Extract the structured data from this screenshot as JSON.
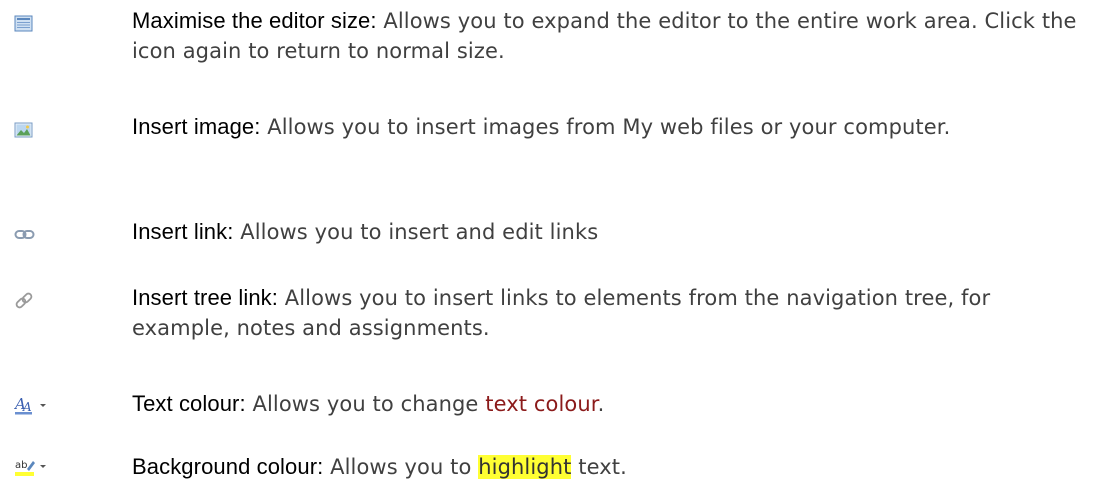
{
  "items": [
    {
      "icon": "maximise-editor-icon",
      "term": "Maximise the editor size:",
      "desc": " Allows you to expand the editor to the entire work area. Click the icon again to return to normal size."
    },
    {
      "icon": "insert-image-icon",
      "term": "Insert image:",
      "desc": " Allows you to insert images from My web files or your computer."
    },
    {
      "icon": "insert-link-icon",
      "term": "Insert link:",
      "desc": " Allows you to insert and edit links"
    },
    {
      "icon": "insert-tree-link-icon",
      "term": "Insert tree link:",
      "desc": " Allows you to insert links to elements from the navigation tree, for example, notes and assignments."
    },
    {
      "icon": "text-colour-icon",
      "term": "Text colour:",
      "desc_before": " Allows you to change ",
      "desc_colored": "text colour",
      "desc_after": "."
    },
    {
      "icon": "background-colour-icon",
      "term": "Background colour:",
      "desc_before": " Allows you to ",
      "desc_highlight": "highlight",
      "desc_after": " text."
    }
  ],
  "colors": {
    "term": "#000000",
    "description": "#404040",
    "text_colour_example": "#8b1a1a",
    "highlight": "#ffff33"
  }
}
